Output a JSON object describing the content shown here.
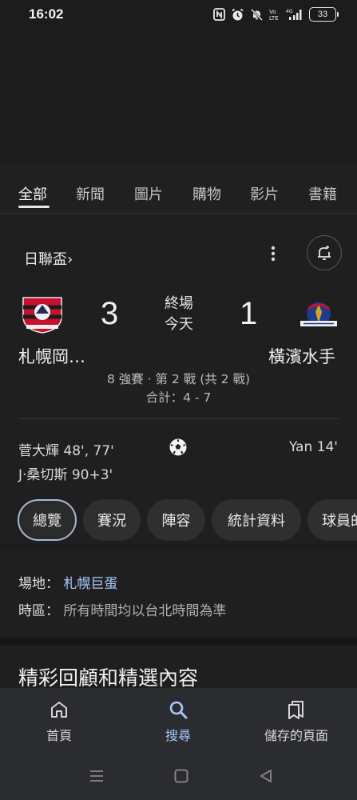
{
  "status_bar": {
    "time": "16:02",
    "battery": "33",
    "icons": [
      "nfc-icon",
      "alarm-icon",
      "mute-icon",
      "volte-icon",
      "signal-icon",
      "battery-icon"
    ]
  },
  "tabs": [
    {
      "label": "全部",
      "active": true
    },
    {
      "label": "新聞"
    },
    {
      "label": "圖片"
    },
    {
      "label": "購物"
    },
    {
      "label": "影片"
    },
    {
      "label": "書籍"
    }
  ],
  "match": {
    "league": "日聯盃",
    "league_chevron": "›",
    "home": {
      "name": "札幌岡…",
      "score": "3"
    },
    "away": {
      "name": "橫濱水手",
      "score": "1"
    },
    "status": "終場",
    "day": "今天",
    "round": "8 強賽 · 第 2 戰 (共 2 戰)",
    "aggregate": "合計：4 - 7",
    "home_scorers": [
      "菅大輝 48', 77'",
      "J·桑切斯 90+3'"
    ],
    "away_scorers": [
      "Yan 14'"
    ]
  },
  "chips": [
    "總覽",
    "賽況",
    "陣容",
    "統計資料",
    "球員的"
  ],
  "venue": {
    "label": "場地：",
    "value": "札幌巨蛋"
  },
  "timezone": {
    "label": "時區：",
    "value": "所有時間均以台北時間為準"
  },
  "highlights_title": "精彩回顧和精選內容",
  "bottom_nav": [
    {
      "label": "首頁",
      "icon": "home-icon"
    },
    {
      "label": "搜尋",
      "icon": "search-icon",
      "active": true
    },
    {
      "label": "儲存的頁面",
      "icon": "saved-pages-icon"
    }
  ],
  "colors": {
    "accent": "#a8c7fa",
    "background": "#1f1f1f",
    "chip": "#2f2f2f"
  }
}
